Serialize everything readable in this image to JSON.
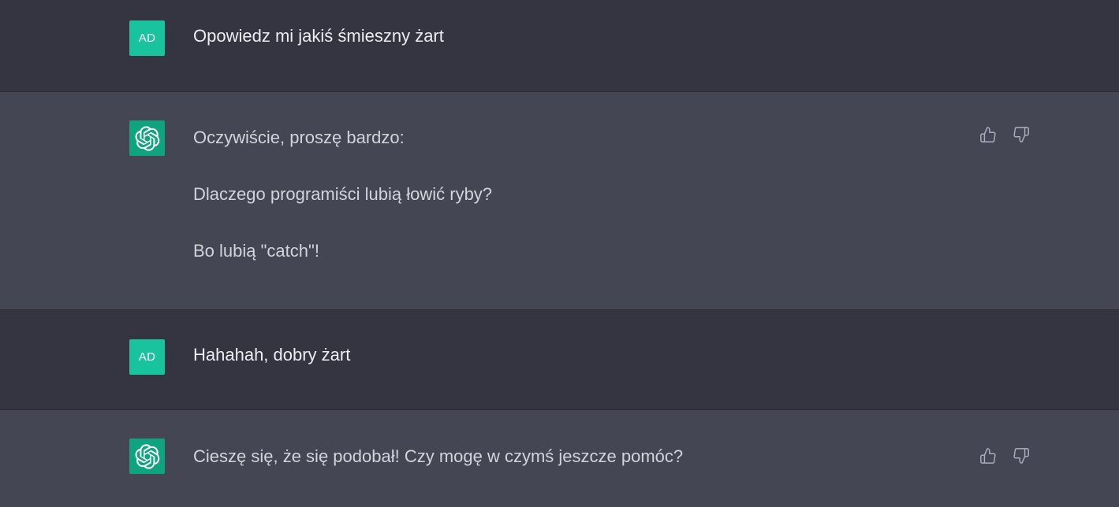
{
  "user": {
    "avatar_initials": "AD",
    "avatar_color": "#19c39d"
  },
  "assistant": {
    "avatar_color": "#10a37f",
    "avatar_icon": "openai-logo-icon"
  },
  "messages": [
    {
      "role": "user",
      "paragraphs": [
        "Opowiedz mi jakiś śmieszny żart"
      ]
    },
    {
      "role": "assistant",
      "paragraphs": [
        "Oczywiście, proszę bardzo:",
        "Dlaczego programiści lubią łowić ryby?",
        "Bo lubią \"catch\"!"
      ],
      "feedback": [
        "thumbs-up-icon",
        "thumbs-down-icon"
      ]
    },
    {
      "role": "user",
      "paragraphs": [
        "Hahahah, dobry żart"
      ]
    },
    {
      "role": "assistant",
      "paragraphs": [
        "Cieszę się, że się podobał! Czy mogę w czymś jeszcze pomóc?"
      ],
      "feedback": [
        "thumbs-up-icon",
        "thumbs-down-icon"
      ]
    }
  ],
  "colors": {
    "user_row_bg": "#343541",
    "assistant_row_bg": "#444654"
  }
}
